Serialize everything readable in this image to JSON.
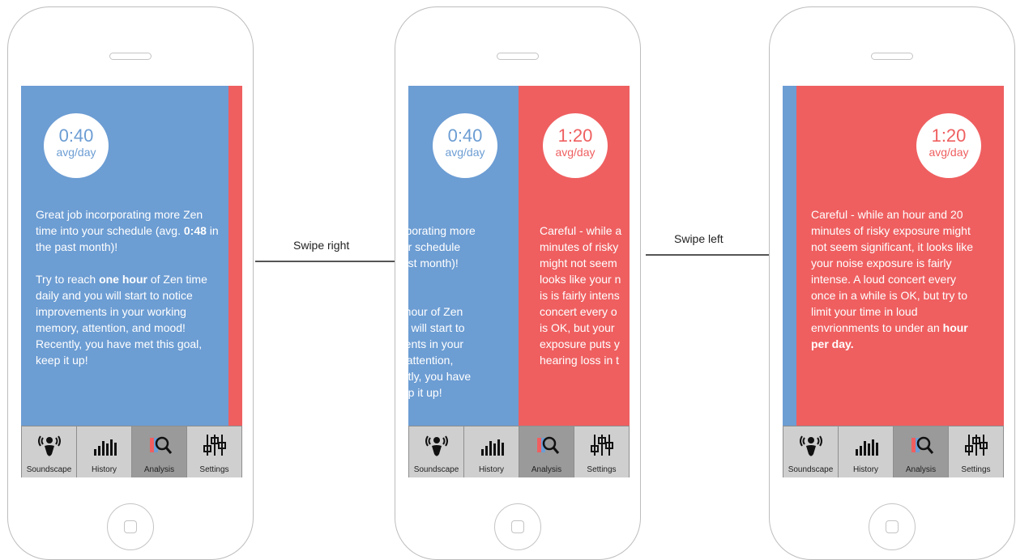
{
  "colors": {
    "zen": "#6c9dd3",
    "risky": "#ef5f60"
  },
  "stats": {
    "zen": {
      "value": "0:40",
      "unit": "avg/day"
    },
    "risky": {
      "value": "1:20",
      "unit": "avg/day"
    }
  },
  "zen_message": {
    "p1_a": "Great job incorporating more Zen time into your schedule (avg. ",
    "p1_b": "0:48",
    "p1_c": " in the past month)!",
    "p2_a": "Try to reach ",
    "p2_b": "one hour",
    "p2_c": " of Zen time daily and you will start to notice improvements in your working memory, attention, and mood! Recently, you have met this goal, keep it up!"
  },
  "mid_zen_fragment": {
    "p1": "orporating more\nour schedule\n past month)!",
    "p2": "e hour of Zen\nou will start to\nments in your\ny, attention,\nently, you have\neep it up!"
  },
  "mid_risky_fragment": {
    "p1": "Careful - while a\nminutes of risky\nmight not seem\nlooks like your n\nis is fairly intens\nconcert every o\nis OK, but your\nexposure puts y\nhearing loss in t"
  },
  "risky_message": {
    "text_a": "Careful - while an hour and 20 minutes of risky exposure might not seem significant, it looks like your noise exposure is fairly intense. A loud concert every once in a while is OK, but try to limit your time in loud envrionments to under an ",
    "text_b": "hour per day."
  },
  "tabs": {
    "soundscape": "Soundscape",
    "history": "History",
    "analysis": "Analysis",
    "settings": "Settings"
  },
  "gestures": {
    "swipe_right": "Swipe right",
    "swipe_left": "Swipe left"
  }
}
